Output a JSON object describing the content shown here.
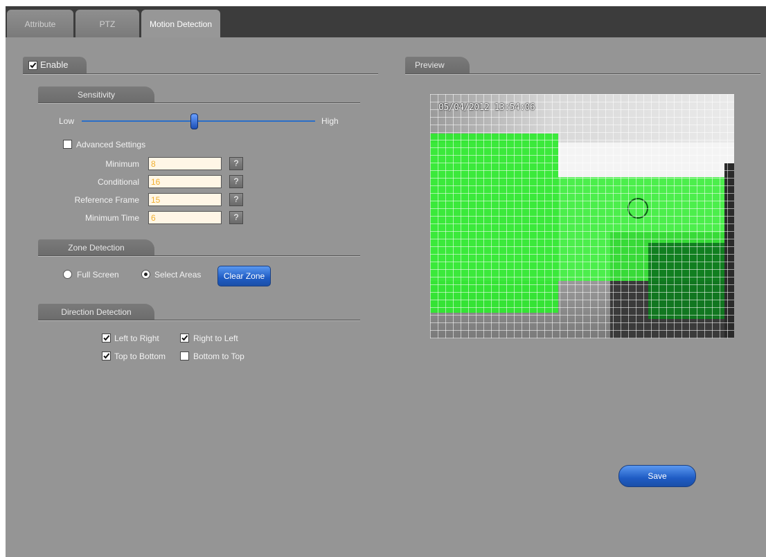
{
  "tabs": [
    {
      "label": "Attribute"
    },
    {
      "label": "PTZ"
    },
    {
      "label": "Motion Detection"
    }
  ],
  "enable": {
    "label": "Enable",
    "checked": true
  },
  "sensitivity": {
    "title": "Sensitivity",
    "low_label": "Low",
    "high_label": "High",
    "level": 0.48
  },
  "advanced": {
    "label": "Advanced Settings",
    "checked": false,
    "fields": [
      {
        "label": "Minimum",
        "value": "8"
      },
      {
        "label": "Conditional",
        "value": "16"
      },
      {
        "label": "Reference Frame",
        "value": "15"
      },
      {
        "label": "Minimum Time",
        "value": "6"
      }
    ],
    "help_label": "?"
  },
  "zone": {
    "title": "Zone Detection",
    "full_screen_label": "Full Screen",
    "select_areas_label": "Select Areas",
    "selected": "select_areas",
    "clear_label": "Clear Zone"
  },
  "direction": {
    "title": "Direction Detection",
    "left_to_right": {
      "label": "Left to Right",
      "checked": true
    },
    "right_to_left": {
      "label": "Right to Left",
      "checked": true
    },
    "top_to_bottom": {
      "label": "Top to Bottom",
      "checked": true
    },
    "bottom_to_top": {
      "label": "Bottom to Top",
      "checked": false
    }
  },
  "preview": {
    "title": "Preview",
    "osd_text": "05/04/2012  13:54:06",
    "zone_color": "#22ee22"
  },
  "save_label": "Save",
  "colors": {
    "accent": "#1f5cc4",
    "panel": "#959595",
    "tabbar": "#3c3c3c"
  }
}
